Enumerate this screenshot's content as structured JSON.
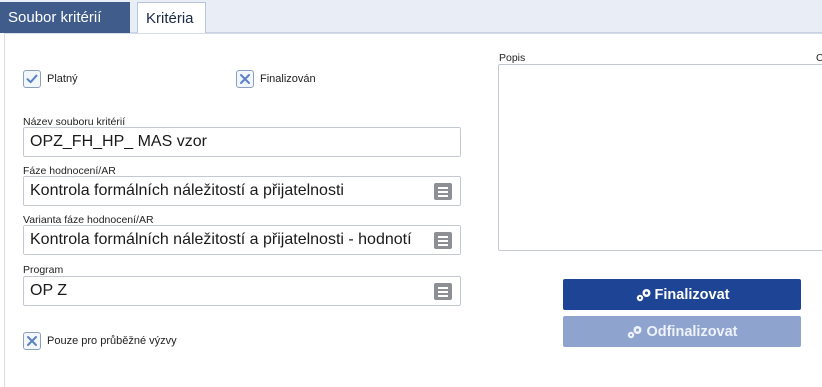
{
  "tabs": [
    {
      "label": "Soubor kritérií"
    },
    {
      "label": "Kritéria"
    }
  ],
  "checkboxes": {
    "platny": {
      "label": "Platný",
      "checked": true
    },
    "finalizovan": {
      "label": "Finalizován",
      "checked": false
    },
    "pouze": {
      "label": "Pouze pro průběžné výzvy",
      "checked": false
    }
  },
  "fields": {
    "nazev": {
      "label": "Název souboru kritérií",
      "value": "OPZ_FH_HP_ MAS vzor"
    },
    "faze": {
      "label": "Fáze hodnocení/AR",
      "value": "Kontrola formálních náležitostí a přijatelnosti"
    },
    "varianta": {
      "label": "Varianta fáze hodnocení/AR",
      "value": "Kontrola formálních náležitostí a přijatelnosti - hodnotí"
    },
    "program": {
      "label": "Program",
      "value": "OP Z"
    }
  },
  "popis": {
    "label": "Popis",
    "right_label": "C",
    "value": ""
  },
  "buttons": {
    "finalizovat": "Finalizovat",
    "odfinalizovat": "Odfinalizovat"
  },
  "colors": {
    "accent": "#1e4595",
    "tab_active": "#3f5c8a",
    "disabled": "#8fa3cf"
  }
}
